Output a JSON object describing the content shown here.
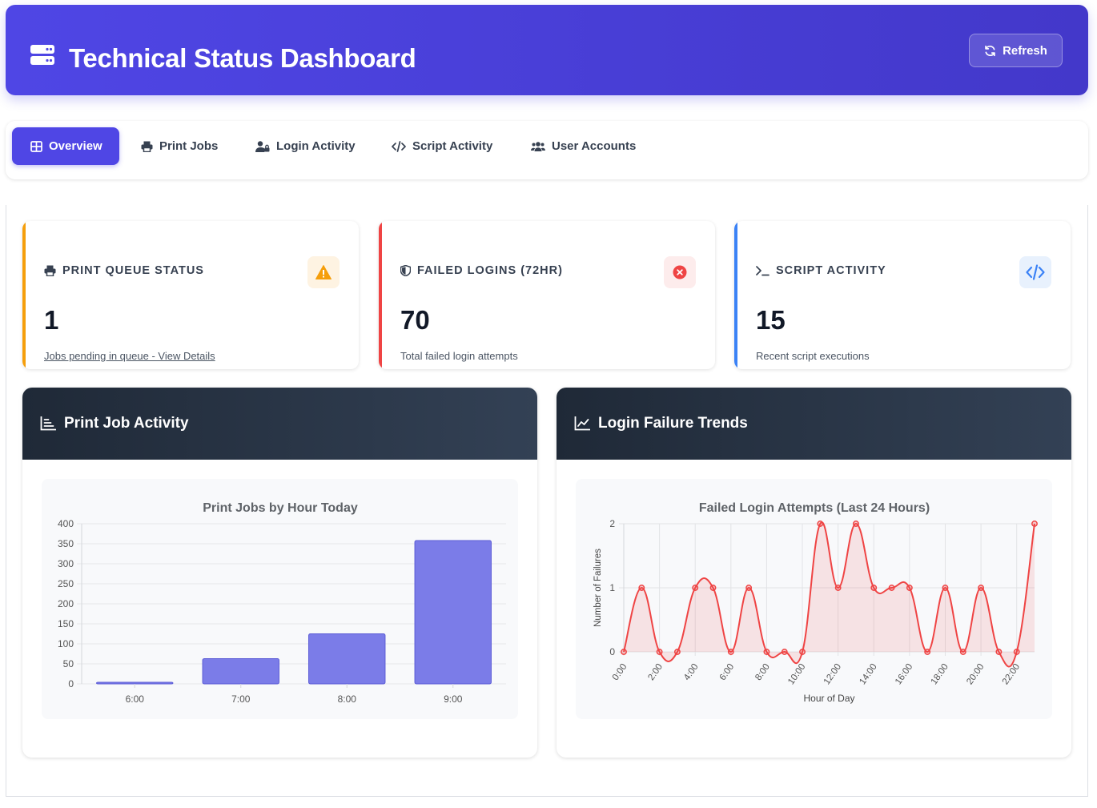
{
  "header": {
    "title": "Technical Status Dashboard",
    "refresh_label": "Refresh",
    "logo_icon": "server-icon",
    "refresh_icon": "refresh-icon"
  },
  "tabs": [
    {
      "label": "Overview",
      "icon": "grid-icon",
      "active": true
    },
    {
      "label": "Print Jobs",
      "icon": "printer-icon",
      "active": false
    },
    {
      "label": "Login Activity",
      "icon": "user-lock-icon",
      "active": false
    },
    {
      "label": "Script Activity",
      "icon": "code-icon",
      "active": false
    },
    {
      "label": "User Accounts",
      "icon": "users-icon",
      "active": false
    }
  ],
  "stats": [
    {
      "title": "PRINT QUEUE STATUS",
      "icon": "printer-icon",
      "badge_icon": "warning-icon",
      "value": "1",
      "sub": "Jobs pending in queue - View Details",
      "accent": "#f59e0b",
      "badge_bg": "#fef3e2"
    },
    {
      "title": "FAILED LOGINS (72HR)",
      "icon": "shield-icon",
      "badge_icon": "error-circle-icon",
      "value": "70",
      "sub": "Total failed login attempts",
      "accent": "#ef4444",
      "badge_bg": "#fdecec"
    },
    {
      "title": "SCRIPT ACTIVITY",
      "icon": "terminal-icon",
      "badge_icon": "code-icon",
      "value": "15",
      "sub": "Recent script executions",
      "accent": "#3b82f6",
      "badge_bg": "#e8f1fd"
    }
  ],
  "panels": {
    "print": {
      "title": "Print Job Activity",
      "icon": "bar-chart-icon"
    },
    "login": {
      "title": "Login Failure Trends",
      "icon": "line-chart-icon"
    }
  },
  "chart_data": [
    {
      "type": "bar",
      "title": "Print Jobs by Hour Today",
      "xlabel": "",
      "ylabel": "",
      "categories": [
        "6:00",
        "7:00",
        "8:00",
        "9:00"
      ],
      "values": [
        4,
        63,
        125,
        358
      ],
      "ylim": [
        0,
        400
      ],
      "yticks": [
        0,
        50,
        100,
        150,
        200,
        250,
        300,
        350,
        400
      ],
      "grid": true,
      "color": "#7b7ce8",
      "border_color": "#5b5bd6"
    },
    {
      "type": "line",
      "title": "Failed Login Attempts (Last 24 Hours)",
      "xlabel": "Hour of Day",
      "ylabel": "Number of Failures",
      "x": [
        0,
        1,
        2,
        3,
        4,
        5,
        6,
        7,
        8,
        9,
        10,
        11,
        12,
        13,
        14,
        15,
        16,
        17,
        18,
        19,
        20,
        21,
        22,
        23
      ],
      "xticks": [
        "0:00",
        "2:00",
        "4:00",
        "6:00",
        "8:00",
        "10:00",
        "12:00",
        "14:00",
        "16:00",
        "18:00",
        "20:00",
        "22:00"
      ],
      "values": [
        0,
        1,
        0,
        0,
        1,
        1,
        0,
        1,
        0,
        0,
        0,
        2,
        1,
        2,
        1,
        1,
        1,
        0,
        1,
        0,
        1,
        0,
        0,
        2
      ],
      "ylim": [
        0,
        2
      ],
      "yticks": [
        0,
        1,
        2
      ],
      "grid": true,
      "fill": true,
      "color": "#ef4444"
    }
  ]
}
